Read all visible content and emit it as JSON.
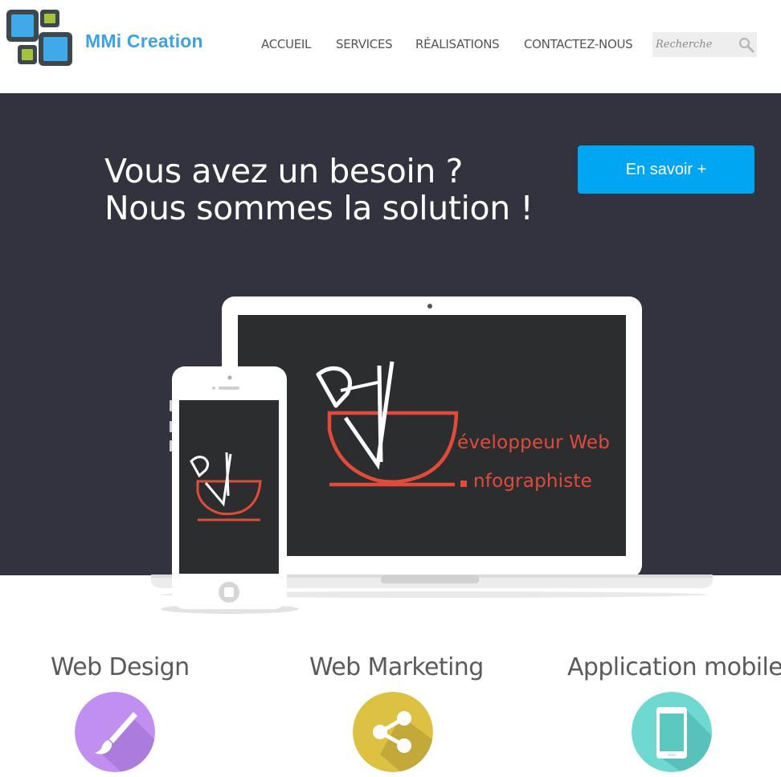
{
  "header": {
    "brand": "MMi Creation",
    "nav": [
      {
        "label": "ACCUEIL"
      },
      {
        "label": "SERVICES"
      },
      {
        "label": "RÉALISATIONS"
      },
      {
        "label": "CONTACTEZ-NOUS"
      }
    ],
    "search": {
      "placeholder": "Recherche",
      "icon": "search-icon"
    }
  },
  "hero": {
    "headline_line1": "Vous avez un besoin ?",
    "headline_line2": "Nous sommes la solution !",
    "cta_label": "En savoir +",
    "background_color": "#32333f",
    "accent_color": "#00a6f2",
    "screen_text_line1": "éveloppeur Web",
    "screen_text_line2": "nfographiste"
  },
  "services": [
    {
      "title": "Web Design",
      "icon": "paintbrush-icon",
      "color": "#c18ff0"
    },
    {
      "title": "Web Marketing",
      "icon": "share-icon",
      "color": "#dcc142"
    },
    {
      "title": "Application mobile",
      "icon": "smartphone-icon",
      "color": "#6fd8d0"
    }
  ]
}
